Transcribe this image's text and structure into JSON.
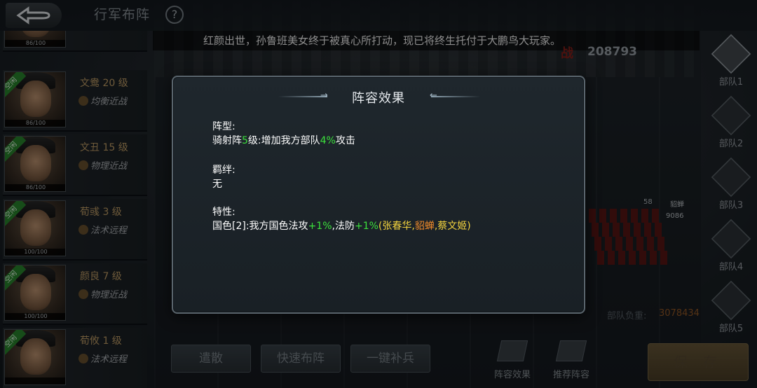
{
  "header": {
    "title": "行军布阵",
    "help": "?"
  },
  "marquee": "红颜出世，孙鲁班美女终于被真心所打动，现已将终生托付于大鹏鸟大玩家。",
  "power": "208793",
  "heroes": [
    {
      "name": "",
      "type": "",
      "hp": "86/100",
      "idle": false
    },
    {
      "name": "文鸯 20 级",
      "type": "均衡近战",
      "hp": "86/100",
      "idle": true
    },
    {
      "name": "文丑 15 级",
      "type": "物理近战",
      "hp": "86/100",
      "idle": true
    },
    {
      "name": "荀彧 3 级",
      "type": "法术远程",
      "hp": "100/100",
      "idle": true
    },
    {
      "name": "颜良 7 级",
      "type": "物理近战",
      "hp": "100/100",
      "idle": true
    },
    {
      "name": "荀攸 1 级",
      "type": "法术远程",
      "hp": "",
      "idle": true
    }
  ],
  "idle_tag": "空闲",
  "squads": [
    "部队1",
    "部队2",
    "部队3",
    "部队4",
    "部队5"
  ],
  "army_load": {
    "label": "部队负重:",
    "value": "3078434"
  },
  "unit": {
    "level": "58",
    "name": "貂蝉",
    "count": "9086"
  },
  "bottom": {
    "disband": "遣散",
    "quick_deploy": "快速布阵",
    "refill": "一键补兵",
    "lineup_effect": "阵容效果",
    "recommend": "推荐阵容",
    "save": "保 存"
  },
  "modal": {
    "title": "阵容效果",
    "formation_head": "阵型:",
    "formation_name": "骑射阵",
    "formation_level": "5",
    "formation_mid": "级:增加我方部队",
    "formation_pct": "4%",
    "formation_end": "攻击",
    "bond_head": "羁绊:",
    "bond_body": "无",
    "trait_head": "特性:",
    "trait_prefix": "国色[2]:我方国色法攻",
    "trait_atk": "+1%",
    "trait_mid": ",法防",
    "trait_def": "+1%",
    "trait_open": "(",
    "hero1": "张春华",
    "comma1": ",",
    "hero2": "貂蝉",
    "comma2": ",",
    "hero3": "蔡文姬",
    "trait_close": ")"
  }
}
